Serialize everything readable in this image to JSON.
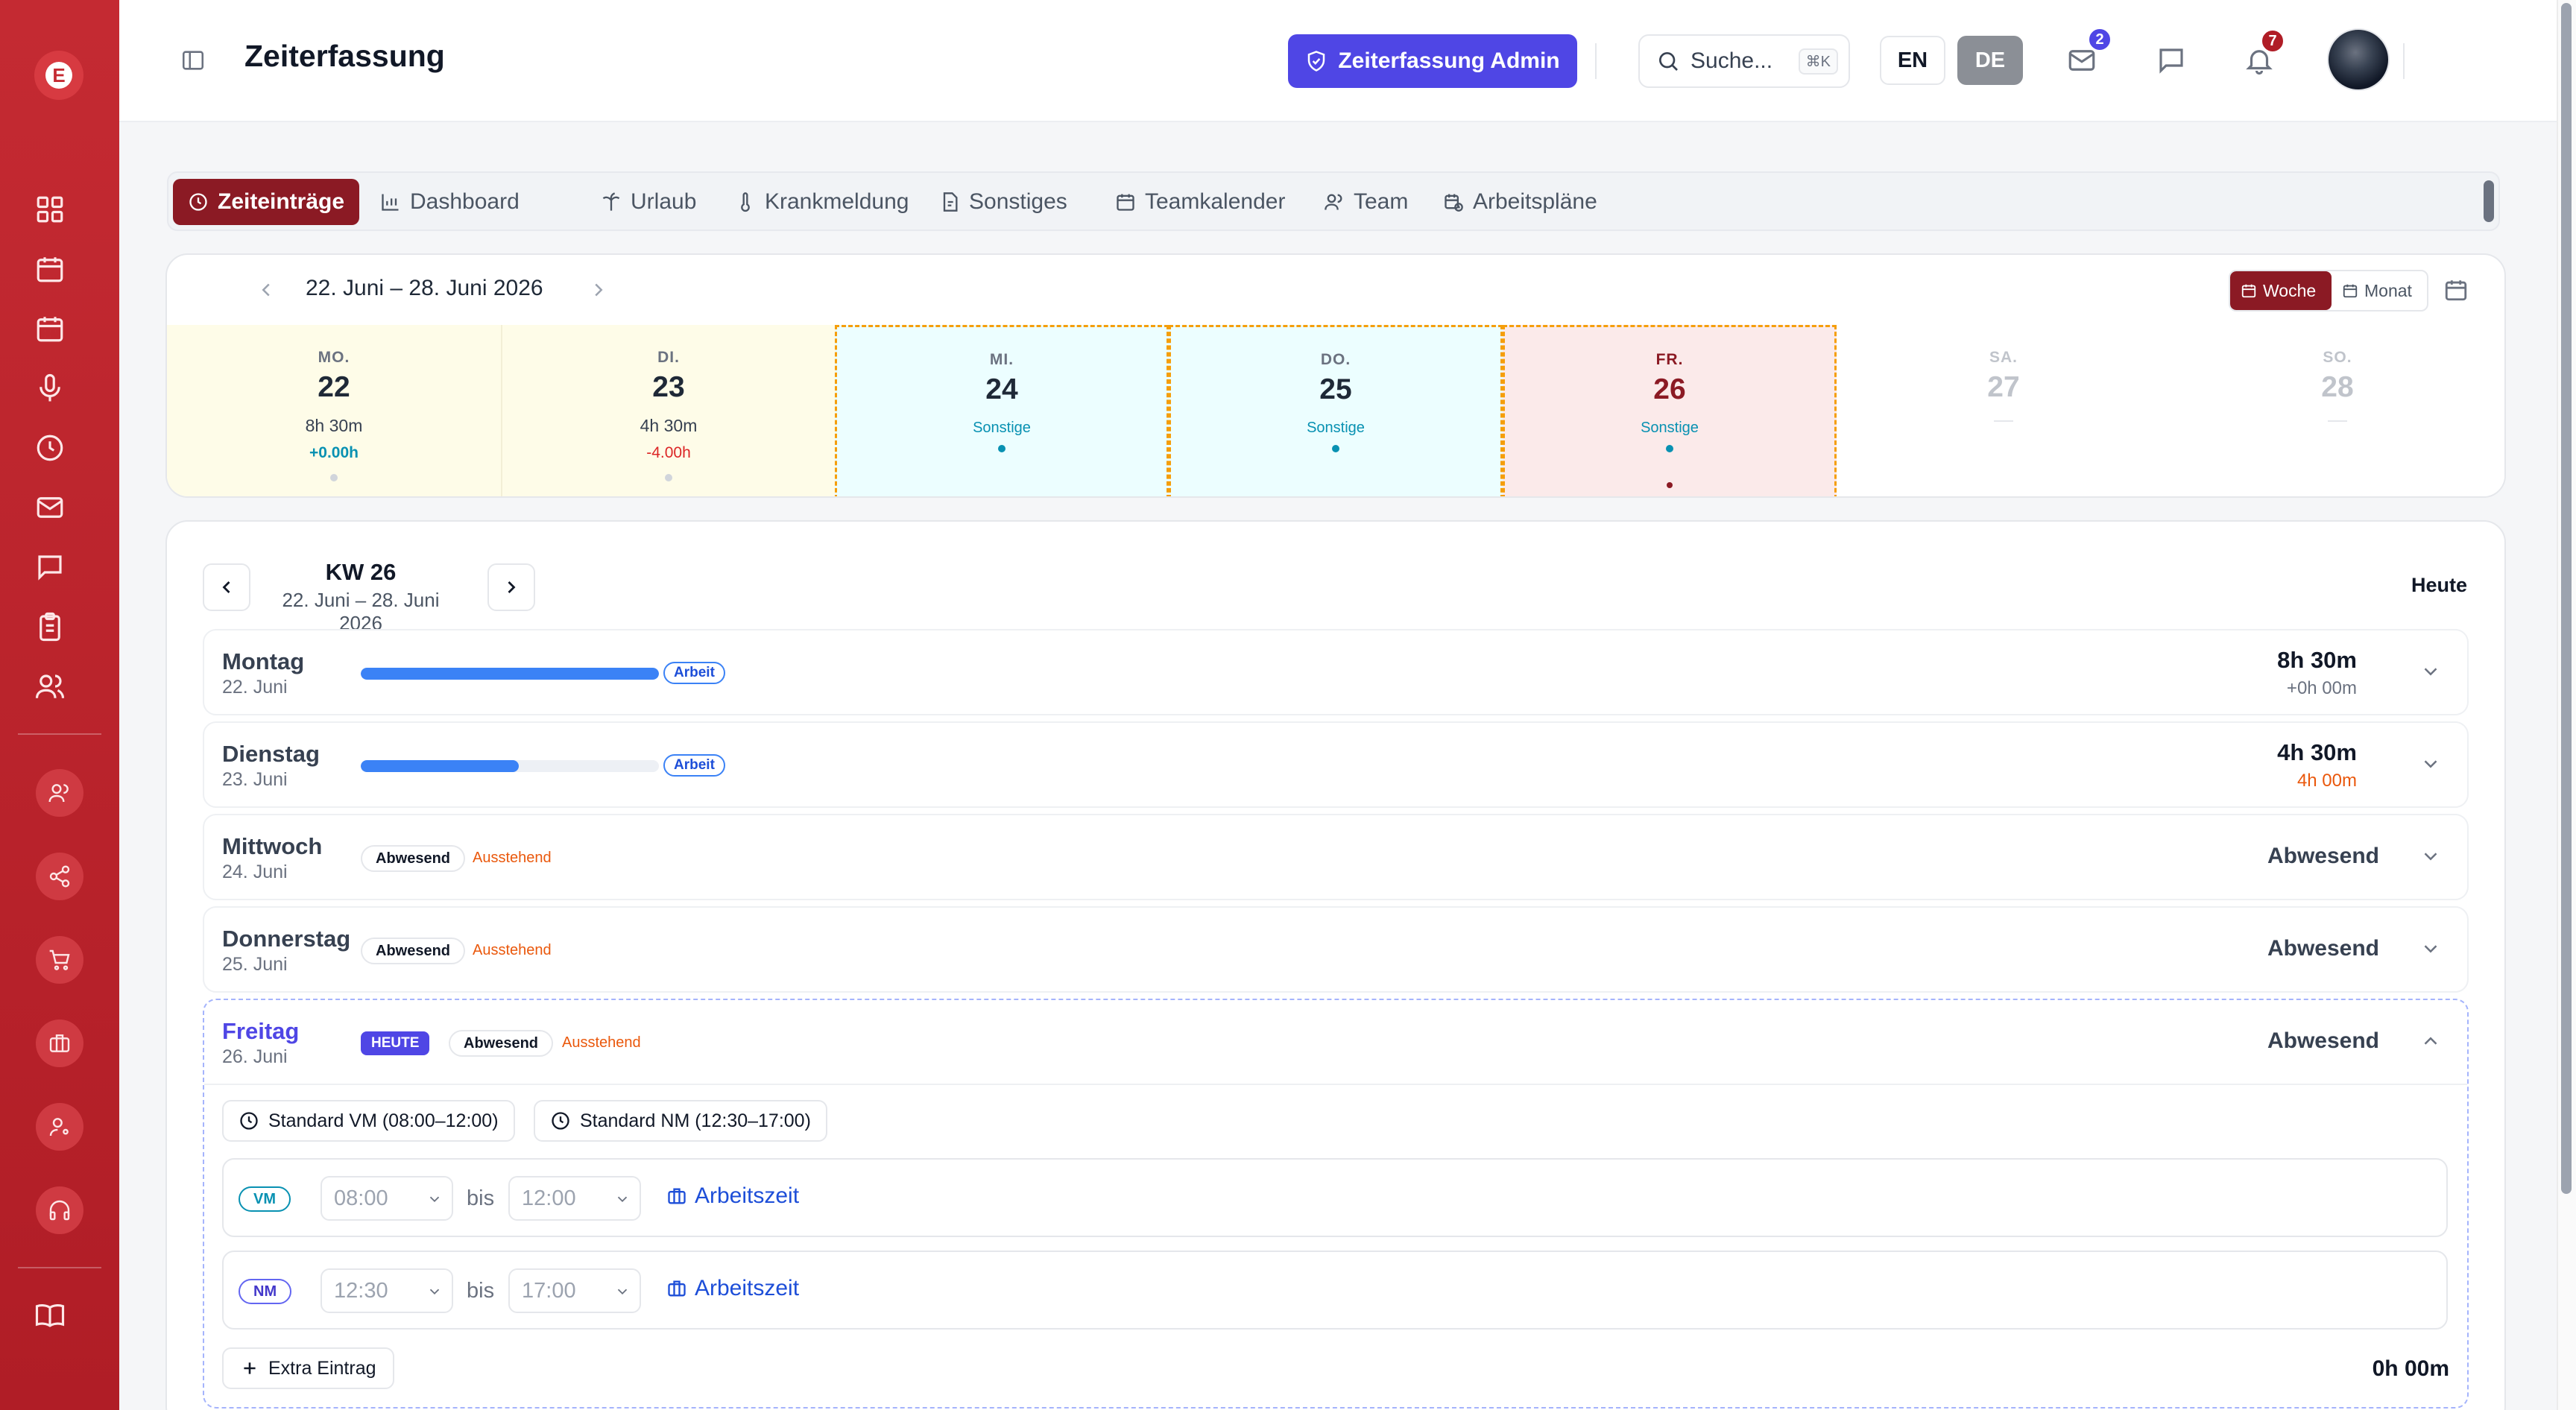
{
  "app": {
    "logo_letter": "E"
  },
  "header": {
    "title": "Zeiterfassung",
    "admin_button": "Zeiterfassung Admin",
    "search_placeholder": "Suche...",
    "search_shortcut": "⌘K",
    "lang_en": "EN",
    "lang_de": "DE",
    "mail_badge": "2",
    "notifications_badge": "7"
  },
  "colors": {
    "brand": "#b01d26",
    "brand_dark": "#8b1a24",
    "accent": "#4f46e5",
    "progress": "#3b82f6",
    "pending": "#ea580c"
  },
  "tabs": [
    {
      "label": "Zeiteinträge",
      "icon": "clock-icon"
    },
    {
      "label": "Dashboard",
      "icon": "bar-chart-icon"
    },
    {
      "label": "Urlaub",
      "icon": "palm-tree-icon"
    },
    {
      "label": "Krankmeldung",
      "icon": "thermometer-icon"
    },
    {
      "label": "Sonstiges",
      "icon": "document-icon"
    },
    {
      "label": "Teamkalender",
      "icon": "calendar-icon"
    },
    {
      "label": "Team",
      "icon": "users-icon"
    },
    {
      "label": "Arbeitspläne",
      "icon": "calendar-clock-icon"
    }
  ],
  "week_strip": {
    "range": "22. Juni – 28. Juni 2026",
    "view_week": "Woche",
    "view_month": "Monat",
    "days": [
      {
        "weekday": "MO.",
        "day": "22",
        "hours": "8h 30m",
        "delta": "+0.00h"
      },
      {
        "weekday": "DI.",
        "day": "23",
        "hours": "4h 30m",
        "delta": "-4.00h"
      },
      {
        "weekday": "MI.",
        "day": "24",
        "category": "Sonstige"
      },
      {
        "weekday": "DO.",
        "day": "25",
        "category": "Sonstige"
      },
      {
        "weekday": "FR.",
        "day": "26",
        "category": "Sonstige"
      },
      {
        "weekday": "SA.",
        "day": "27",
        "empty": "—"
      },
      {
        "weekday": "SO.",
        "day": "28",
        "empty": "—"
      }
    ]
  },
  "week_detail": {
    "kw": "KW 26",
    "range": "22. Juni – 28. Juni 2026",
    "today_button": "Heute",
    "rows": [
      {
        "name": "Montag",
        "date": "22. Juni",
        "progress": 1.0,
        "tag": "Arbeit",
        "total": "8h 30m",
        "diff": "+0h 00m"
      },
      {
        "name": "Dienstag",
        "date": "23. Juni",
        "progress": 0.53,
        "tag": "Arbeit",
        "total": "4h 30m",
        "diff": "4h 00m"
      },
      {
        "name": "Mittwoch",
        "date": "24. Juni",
        "absent_tag": "Abwesend",
        "status": "Ausstehend",
        "total": "Abwesend"
      },
      {
        "name": "Donnerstag",
        "date": "25. Juni",
        "absent_tag": "Abwesend",
        "status": "Ausstehend",
        "total": "Abwesend"
      },
      {
        "name": "Freitag",
        "date": "26. Juni",
        "today_tag": "HEUTE",
        "absent_tag": "Abwesend",
        "status": "Ausstehend",
        "total": "Abwesend"
      }
    ],
    "friday": {
      "template_vm": "Standard VM (08:00–12:00)",
      "template_nm": "Standard NM (12:30–17:00)",
      "slots": [
        {
          "tag": "VM",
          "from": "08:00",
          "to": "12:00",
          "bis": "bis",
          "type": "Arbeitszeit"
        },
        {
          "tag": "NM",
          "from": "12:30",
          "to": "17:00",
          "bis": "bis",
          "type": "Arbeitszeit"
        }
      ],
      "extra_button": "Extra Eintrag",
      "total": "0h 00m"
    }
  }
}
